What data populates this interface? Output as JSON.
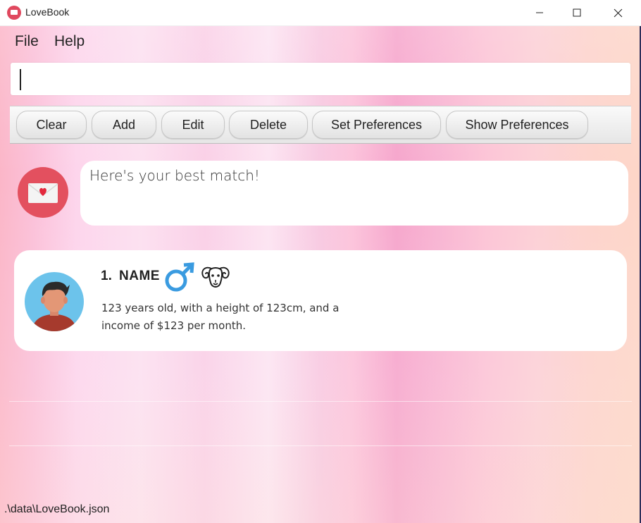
{
  "window": {
    "title": "LoveBook",
    "controls": [
      "minimize",
      "maximize",
      "close"
    ]
  },
  "menu": {
    "items": [
      {
        "label": "File"
      },
      {
        "label": "Help"
      }
    ]
  },
  "command_input": {
    "value": "",
    "placeholder": ""
  },
  "toolbar": {
    "buttons": [
      {
        "label": "Clear"
      },
      {
        "label": "Add"
      },
      {
        "label": "Edit"
      },
      {
        "label": "Delete"
      },
      {
        "label": "Set Preferences"
      },
      {
        "label": "Show Preferences"
      }
    ]
  },
  "result": {
    "message": "Here's your best match!",
    "icon": "love-letter-icon"
  },
  "match_card": {
    "index": "1.",
    "name": "NAME",
    "gender_icon": "male-symbol-icon",
    "zodiac_icon": "aries-ram-icon",
    "description": "123 years old, with a height of 123cm, and a income of $123 per month."
  },
  "status": {
    "path": ".\\data\\LoveBook.json"
  },
  "colors": {
    "accent": "#e3505f",
    "gender_blue": "#3a9be0",
    "avatar_bg": "#6cc3eb"
  }
}
